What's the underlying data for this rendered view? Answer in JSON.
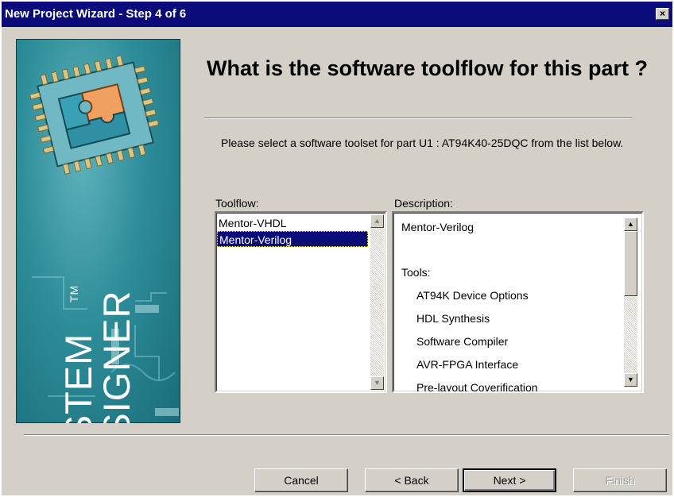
{
  "window": {
    "title": "New Project Wizard - Step 4 of 6",
    "close_glyph": "×"
  },
  "banner": {
    "brand_line1": "SYSTEM",
    "brand_line2": "DESIGNER",
    "trademark": "TM"
  },
  "heading": "What is the software toolflow for this part ?",
  "prompt": "Please select a software toolset for part U1 : AT94K40-25DQC from the list below.",
  "toolflow": {
    "label": "Toolflow:",
    "items": [
      "Mentor-VHDL",
      "Mentor-Verilog"
    ],
    "selected": "Mentor-Verilog"
  },
  "description": {
    "label": "Description:",
    "title": "Mentor-Verilog",
    "tools_label": "Tools:",
    "tools": [
      "AT94K Device Options",
      "HDL Synthesis",
      "Software Compiler",
      "AVR-FPGA Interface",
      "Pre-layout Coverification"
    ]
  },
  "buttons": {
    "cancel": "Cancel",
    "back": "< Back",
    "next": "Next >",
    "finish": "Finish"
  },
  "colors": {
    "titlebar": "#0b0b7a",
    "dialog": "#d4d0c8",
    "selection": "#0b0b7a",
    "banner": "#1f7a88"
  }
}
